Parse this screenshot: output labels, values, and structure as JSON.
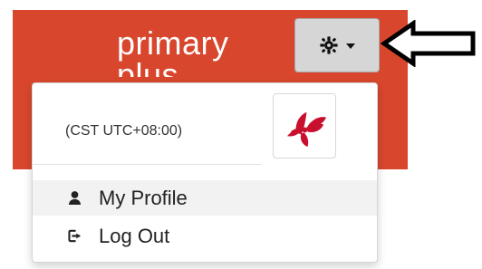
{
  "header": {
    "brand_line_1": "primary",
    "brand_line_2": "plus",
    "accent_color": "#d8472d",
    "settings_button_icons": [
      "gear-icon",
      "chevron-down-icon"
    ]
  },
  "dropdown": {
    "timezone": "(CST UTC+08:00)",
    "avatar_icon": "fan-avatar-icon",
    "items": [
      {
        "label": "My Profile",
        "icon": "user-icon"
      },
      {
        "label": "Log Out",
        "icon": "logout-icon"
      }
    ]
  },
  "annotation": {
    "icon": "arrow-left-icon"
  }
}
